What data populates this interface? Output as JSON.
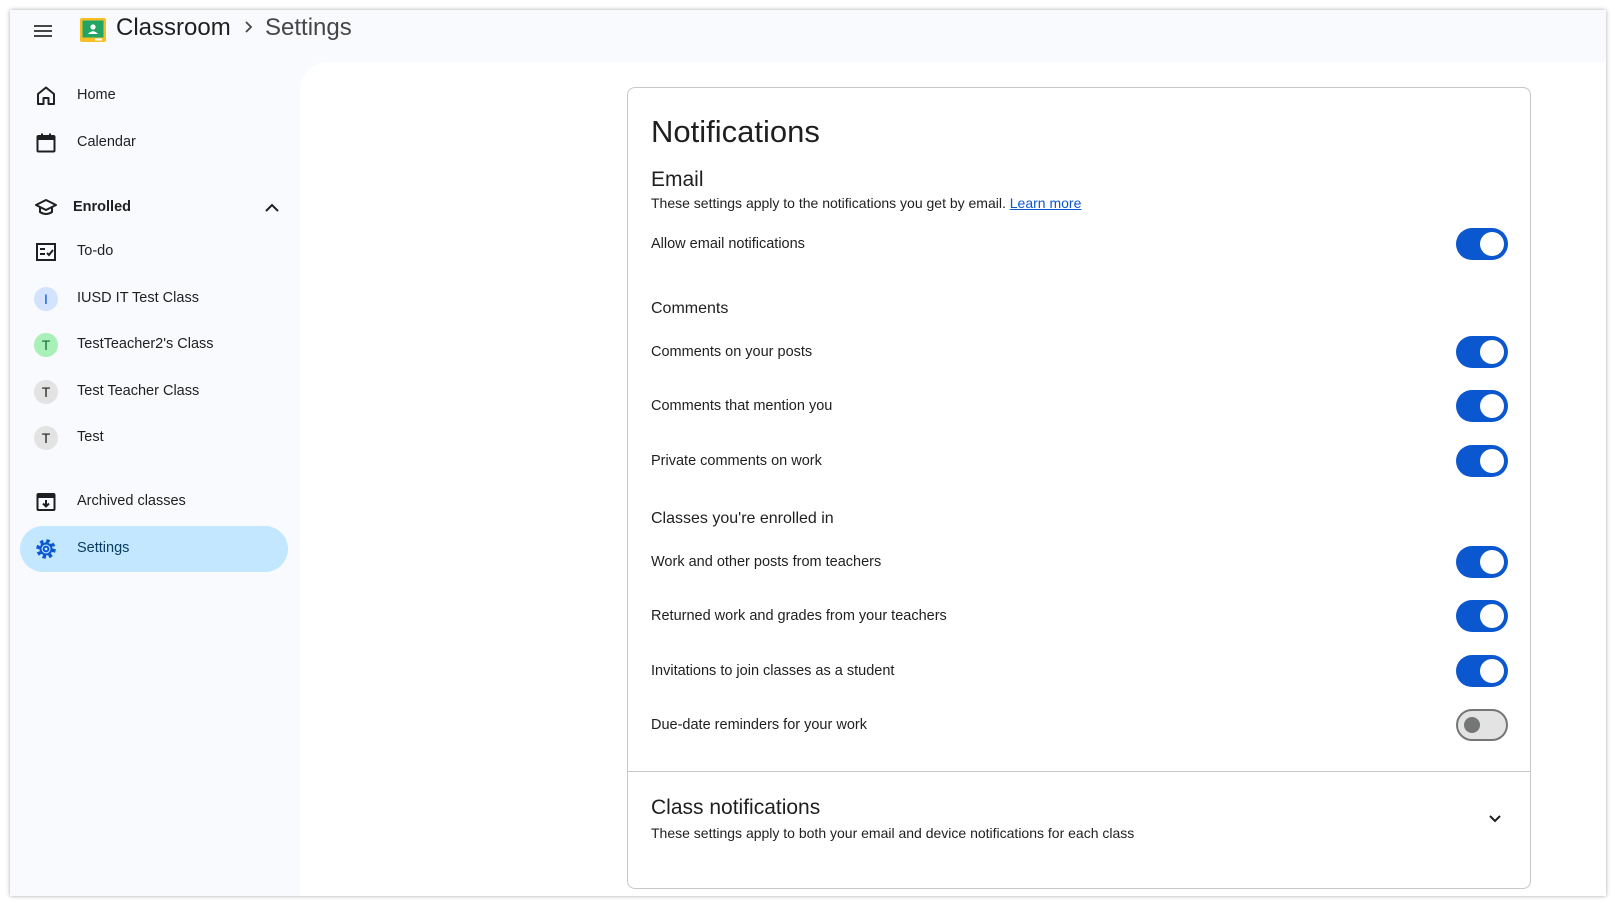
{
  "header": {
    "app_title": "Classroom",
    "page_title": "Settings"
  },
  "sidebar": {
    "home": "Home",
    "calendar": "Calendar",
    "enrolled": "Enrolled",
    "todo": "To-do",
    "classes": [
      {
        "initial": "I",
        "label": "IUSD IT Test Class",
        "color": "#0b57d0",
        "bg": "#d3e3fd"
      },
      {
        "initial": "T",
        "label": "TestTeacher2's Class",
        "color": "#146c2e",
        "bg": "#a8f0b8"
      },
      {
        "initial": "T",
        "label": "Test Teacher Class",
        "color": "#1f1f1f",
        "bg": "#e3e3e3"
      },
      {
        "initial": "T",
        "label": "Test",
        "color": "#1f1f1f",
        "bg": "#e3e3e3"
      }
    ],
    "archived": "Archived classes",
    "settings": "Settings"
  },
  "notifications": {
    "title": "Notifications",
    "email": {
      "title": "Email",
      "description": "These settings apply to the notifications you get by email.",
      "learn_more": "Learn more",
      "allow_label": "Allow email notifications",
      "allow_on": true
    },
    "comments": {
      "title": "Comments",
      "rows": [
        {
          "label": "Comments on your posts",
          "on": true
        },
        {
          "label": "Comments that mention you",
          "on": true
        },
        {
          "label": "Private comments on work",
          "on": true
        }
      ]
    },
    "enrolled": {
      "title": "Classes you're enrolled in",
      "rows": [
        {
          "label": "Work and other posts from teachers",
          "on": true
        },
        {
          "label": "Returned work and grades from your teachers",
          "on": true
        },
        {
          "label": "Invitations to join classes as a student",
          "on": true
        },
        {
          "label": "Due-date reminders for your work",
          "on": false
        }
      ]
    }
  },
  "class_notifications": {
    "title": "Class notifications",
    "description": "These settings apply to both your email and device notifications for each class"
  },
  "colors": {
    "accent": "#0b57d0",
    "active_nav": "#c2e7ff"
  }
}
